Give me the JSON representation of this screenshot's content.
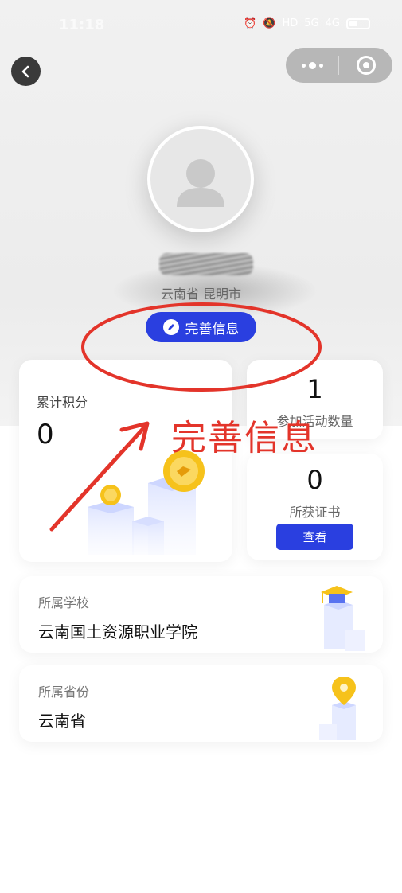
{
  "status_bar": {
    "time": "11:18",
    "icons": [
      "alarm-icon",
      "mute-icon",
      "hd-icon",
      "signal-icon",
      "signal-icon",
      "battery-icon"
    ],
    "hd_label": "HD",
    "signal1_label": "5G",
    "signal2_label": "4G"
  },
  "nav": {
    "back_icon": "chevron-left-icon",
    "more_icon": "more-dots-icon",
    "close_icon": "target-close-icon"
  },
  "profile": {
    "location": "云南省 昆明市",
    "complete_button_label": "完善信息"
  },
  "stats": {
    "points_label": "累计积分",
    "points_value": "0",
    "activity_value": "1",
    "activity_label": "参加活动数量",
    "cert_value": "0",
    "cert_label": "所获证书",
    "view_button_label": "查看"
  },
  "info": {
    "school_label": "所属学校",
    "school_value": "云南国土资源职业学院",
    "province_label": "所属省份",
    "province_value": "云南省"
  },
  "annotation": {
    "text": "完善信息",
    "color": "#e3342a"
  },
  "colors": {
    "accent": "#2a3fe0",
    "coin": "#f6c21b"
  }
}
